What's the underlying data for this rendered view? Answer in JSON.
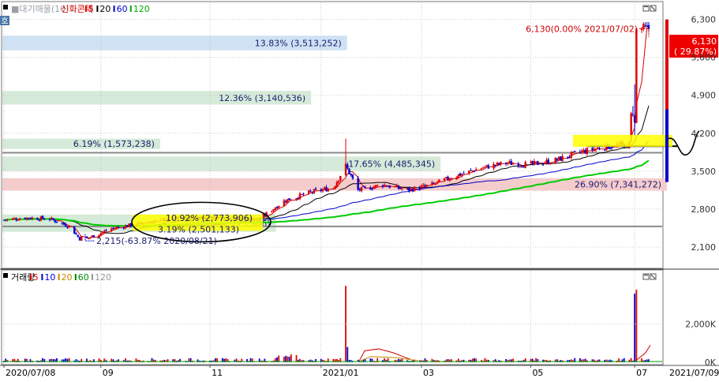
{
  "price_pane": {
    "legend": [
      {
        "text": "■대기매물(10)",
        "color": "#9aa0a8"
      },
      {
        "text": "신화콘텍",
        "color": "#d40000"
      },
      {
        "text": "5",
        "color": "#d40000",
        "tick": true
      },
      {
        "text": "20",
        "color": "#000000",
        "tick": true
      },
      {
        "text": "60",
        "color": "#0000cc",
        "tick": true
      },
      {
        "text": "120",
        "color": "#00aa00",
        "tick": true
      }
    ],
    "corner_label": "호",
    "window_icons": [
      "maximize-icon",
      "close-icon"
    ]
  },
  "volume_pane": {
    "legend": [
      {
        "text": "거래량",
        "color": "#000000"
      },
      {
        "text": "5",
        "color": "#d40000",
        "tick": true
      },
      {
        "text": "10",
        "color": "#0000cc",
        "tick": true
      },
      {
        "text": "20",
        "color": "#cc8800",
        "tick": true
      },
      {
        "text": "60",
        "color": "#008800",
        "tick": true
      },
      {
        "text": "120",
        "color": "#999999",
        "tick": true
      }
    ],
    "window_icons": [
      "maximize-icon",
      "close-icon"
    ]
  },
  "x_axis": {
    "tick_labels": [
      {
        "label": "2020/07/08",
        "date": "2020-07-08"
      },
      {
        "label": "09",
        "date": "2020-09-01"
      },
      {
        "label": "11",
        "date": "2020-11-02"
      },
      {
        "label": "2021/01",
        "date": "2021-01-04"
      },
      {
        "label": "03",
        "date": "2021-03-02"
      },
      {
        "label": "05",
        "date": "2021-05-03"
      },
      {
        "label": "07",
        "date": "2021-07-01"
      }
    ],
    "end_label": "2021/07/09"
  },
  "chart_data": [
    {
      "type": "candlestick",
      "title": "신화콘텍",
      "y_ticks": [
        2100,
        2800,
        3500,
        4200,
        4900,
        5600,
        6300
      ],
      "y_tick_labels": [
        "2,100",
        "2,800",
        "3,500",
        "4,200",
        "4,900",
        "5,600",
        "6,300"
      ],
      "ylim": [
        1750,
        6600
      ],
      "moving_averages": [
        "5",
        "20",
        "60",
        "120"
      ],
      "price_path": [
        {
          "date": "2020-07-08",
          "close": 2600
        },
        {
          "date": "2020-07-20",
          "close": 2640
        },
        {
          "date": "2020-08-03",
          "close": 2620
        },
        {
          "date": "2020-08-14",
          "close": 2480
        },
        {
          "date": "2020-08-21",
          "close": 2215
        },
        {
          "date": "2020-09-07",
          "close": 2440
        },
        {
          "date": "2020-09-21",
          "close": 2520
        },
        {
          "date": "2020-10-06",
          "close": 2600
        },
        {
          "date": "2020-10-20",
          "close": 2640
        },
        {
          "date": "2020-11-02",
          "close": 2660
        },
        {
          "date": "2020-11-16",
          "close": 2620
        },
        {
          "date": "2020-11-30",
          "close": 2620
        },
        {
          "date": "2020-12-14",
          "close": 2950
        },
        {
          "date": "2020-12-28",
          "close": 3100
        },
        {
          "date": "2021-01-11",
          "close": 3200
        },
        {
          "date": "2021-01-18",
          "close": 3600
        },
        {
          "date": "2021-01-25",
          "close": 3150
        },
        {
          "date": "2021-02-08",
          "close": 3250
        },
        {
          "date": "2021-02-22",
          "close": 3150
        },
        {
          "date": "2021-03-08",
          "close": 3250
        },
        {
          "date": "2021-03-22",
          "close": 3420
        },
        {
          "date": "2021-04-05",
          "close": 3560
        },
        {
          "date": "2021-04-19",
          "close": 3650
        },
        {
          "date": "2021-05-03",
          "close": 3620
        },
        {
          "date": "2021-05-17",
          "close": 3700
        },
        {
          "date": "2021-05-31",
          "close": 3850
        },
        {
          "date": "2021-06-14",
          "close": 3950
        },
        {
          "date": "2021-06-28",
          "close": 4000
        },
        {
          "date": "2021-07-02",
          "close": 6130
        },
        {
          "date": "2021-07-09",
          "close": 6130
        }
      ],
      "supply_zones": [
        {
          "label": "13.83% (3,513,252)",
          "price_low": 5730,
          "price_high": 6000,
          "fill": "#cfe2f3"
        },
        {
          "label": "12.36% (3,140,536)",
          "price_low": 4730,
          "price_high": 4980,
          "fill": "#d5ead8"
        },
        {
          "label": "6.19% (1,573,238)",
          "price_low": 3910,
          "price_high": 4100,
          "fill": "#d5ead8"
        },
        {
          "label": "17.65% (4,485,345)",
          "price_low": 3500,
          "price_high": 3770,
          "fill": "#d5ead8"
        },
        {
          "label": "26.90% (7,341,272)",
          "price_low": 3140,
          "price_high": 3370,
          "fill": "#f4cccc"
        },
        {
          "label": "10.92% (2,773,906)",
          "price_low": 2380,
          "price_high": 2700,
          "fill": "#d5ead8"
        }
      ],
      "annotations": [
        {
          "text": "6,130(0.00% 2021/07/02)",
          "price": 6130
        },
        {
          "text": "2,215(-63.87% 2020/08/21)",
          "price": 2215
        },
        {
          "text": "10.92% (2,773,906)",
          "price": 2640
        },
        {
          "text": "3.19% (2,501,133)",
          "price": 2430
        }
      ],
      "current_price_box": {
        "line1": "6,130",
        "line2": "( 29.87%)"
      },
      "horizontal_lines": [
        3840,
        2480,
        3960
      ]
    },
    {
      "type": "bar",
      "title": "거래량",
      "y_ticks": [
        0,
        2000
      ],
      "y_tick_labels": [
        "0K",
        "2,000K"
      ],
      "unit": "K",
      "spikes": [
        {
          "date": "2021-01-18",
          "volume": 4000
        },
        {
          "date": "2021-07-01",
          "volume": 3600
        },
        {
          "date": "2021-07-02",
          "volume": 3800
        }
      ]
    }
  ]
}
